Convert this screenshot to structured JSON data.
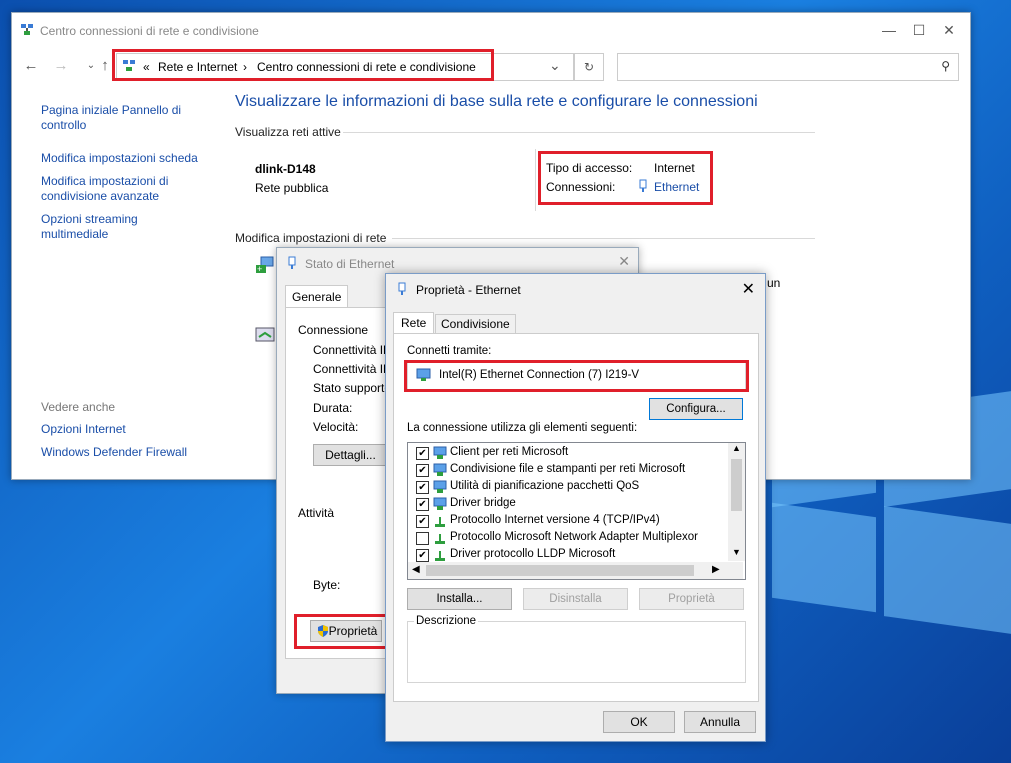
{
  "main_window": {
    "title": "Centro connessioni di rete e condivisione",
    "minimize": "—",
    "maximize": "☐",
    "close": "✕",
    "breadcrumb": {
      "sep0": "«",
      "item1": "Rete e Internet",
      "sep1": "›",
      "item2": "Centro connessioni di rete e condivisione"
    },
    "address_dropdown": "⌄",
    "refresh": "↻",
    "search_placeholder": ""
  },
  "sidebar": {
    "links": [
      "Pagina iniziale Pannello di controllo",
      "Modifica impostazioni scheda",
      "Modifica impostazioni di condivisione avanzate",
      "Opzioni streaming multimediale"
    ],
    "see_also_header": "Vedere anche",
    "see_also": [
      "Opzioni Internet",
      "Windows Defender Firewall"
    ]
  },
  "content": {
    "heading": "Visualizzare le informazioni di base sulla rete e configurare le connessioni",
    "active_networks_label": "Visualizza reti attive",
    "network_name": "dlink-D148",
    "network_type": "Rete pubblica",
    "access_type_label": "Tipo di accesso:",
    "access_type_value": "Internet",
    "connections_label": "Connessioni:",
    "connections_value": "Ethernet",
    "modify_label": "Modifica impostazioni di rete",
    "partial_text": "un"
  },
  "stato_dialog": {
    "title": "Stato di Ethernet",
    "tab": "Generale",
    "connection_header": "Connessione",
    "rows": [
      "Connettività IP",
      "Connettività IP",
      "Stato supporto",
      "Durata:",
      "Velocità:"
    ],
    "details_button": "Dettagli...",
    "activity_header": "Attività",
    "bytes_label": "Byte:",
    "properties_button": "Proprietà"
  },
  "prop_dialog": {
    "title": "Proprietà - Ethernet",
    "close": "✕",
    "tabs": [
      "Rete",
      "Condivisione"
    ],
    "connect_using_label": "Connetti tramite:",
    "adapter_name": "Intel(R) Ethernet Connection (7) I219-V",
    "configure_button": "Configura...",
    "items_label": "La connessione utilizza gli elementi seguenti:",
    "items": [
      {
        "label": "Client per reti Microsoft",
        "checked": true
      },
      {
        "label": "Condivisione file e stampanti per reti Microsoft",
        "checked": true
      },
      {
        "label": "Utilità di pianificazione pacchetti QoS",
        "checked": true
      },
      {
        "label": "Driver bridge",
        "checked": true
      },
      {
        "label": "Protocollo Internet versione 4 (TCP/IPv4)",
        "checked": true
      },
      {
        "label": "Protocollo Microsoft Network Adapter Multiplexor",
        "checked": false
      },
      {
        "label": "Driver protocollo LLDP Microsoft",
        "checked": true
      }
    ],
    "install_button": "Installa...",
    "uninstall_button": "Disinstalla",
    "properties_button": "Proprietà",
    "description_label": "Descrizione",
    "ok_button": "OK",
    "cancel_button": "Annulla"
  },
  "colors": {
    "highlight_red": "#e01f2a",
    "link_blue": "#1a4ea8",
    "desktop_blue": "#1267c4"
  }
}
